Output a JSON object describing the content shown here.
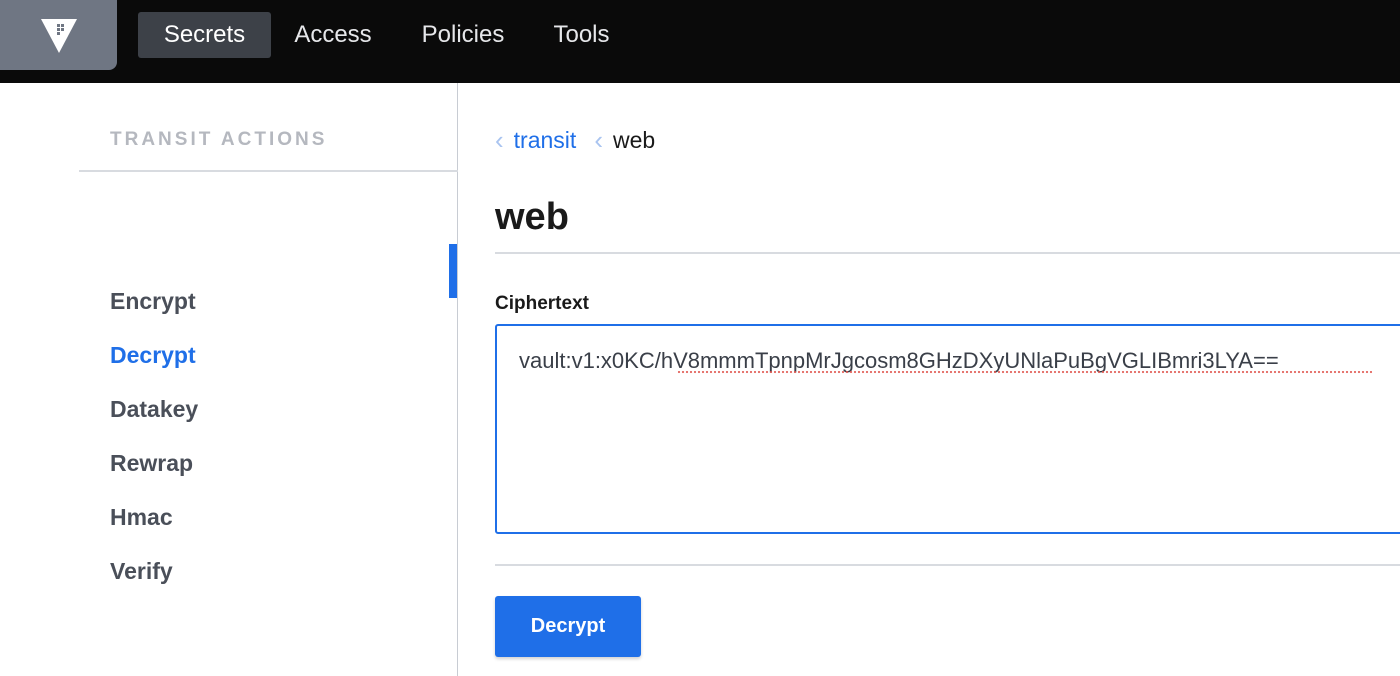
{
  "colors": {
    "topbar": "#0a0a0a",
    "logo_bg": "#6f7683",
    "accent": "#1f6fe8",
    "nav_active_bg": "#3d4148"
  },
  "header": {
    "logo_icon": "vault-triangle-logo-icon",
    "nav": [
      {
        "label": "Secrets",
        "active": true
      },
      {
        "label": "Access",
        "active": false
      },
      {
        "label": "Policies",
        "active": false
      },
      {
        "label": "Tools",
        "active": false
      }
    ]
  },
  "sidebar": {
    "heading": "TRANSIT ACTIONS",
    "items": [
      {
        "label": "Encrypt",
        "active": false
      },
      {
        "label": "Decrypt",
        "active": true
      },
      {
        "label": "Datakey",
        "active": false
      },
      {
        "label": "Rewrap",
        "active": false
      },
      {
        "label": "Hmac",
        "active": false
      },
      {
        "label": "Verify",
        "active": false
      }
    ]
  },
  "breadcrumb": {
    "chevron_icon": "chevron-left-icon",
    "chevron_glyph": "‹",
    "parent": "transit",
    "current": "web"
  },
  "main": {
    "title": "web",
    "field_label": "Ciphertext",
    "ciphertext_value": "vault:v1:x0KC/hV8mmmTpnpMrJgcosm8GHzDXyUNlaPuBgVGLIBmri3LYA==",
    "submit_label": "Decrypt"
  }
}
